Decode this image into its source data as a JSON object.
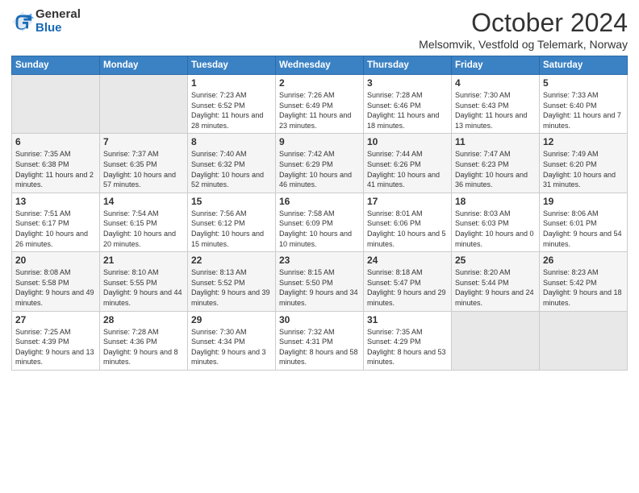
{
  "header": {
    "logo_general": "General",
    "logo_blue": "Blue",
    "month_title": "October 2024",
    "location": "Melsomvik, Vestfold og Telemark, Norway"
  },
  "days_of_week": [
    "Sunday",
    "Monday",
    "Tuesday",
    "Wednesday",
    "Thursday",
    "Friday",
    "Saturday"
  ],
  "weeks": [
    [
      {
        "day": "",
        "info": ""
      },
      {
        "day": "",
        "info": ""
      },
      {
        "day": "1",
        "info": "Sunrise: 7:23 AM\nSunset: 6:52 PM\nDaylight: 11 hours and 28 minutes."
      },
      {
        "day": "2",
        "info": "Sunrise: 7:26 AM\nSunset: 6:49 PM\nDaylight: 11 hours and 23 minutes."
      },
      {
        "day": "3",
        "info": "Sunrise: 7:28 AM\nSunset: 6:46 PM\nDaylight: 11 hours and 18 minutes."
      },
      {
        "day": "4",
        "info": "Sunrise: 7:30 AM\nSunset: 6:43 PM\nDaylight: 11 hours and 13 minutes."
      },
      {
        "day": "5",
        "info": "Sunrise: 7:33 AM\nSunset: 6:40 PM\nDaylight: 11 hours and 7 minutes."
      }
    ],
    [
      {
        "day": "6",
        "info": "Sunrise: 7:35 AM\nSunset: 6:38 PM\nDaylight: 11 hours and 2 minutes."
      },
      {
        "day": "7",
        "info": "Sunrise: 7:37 AM\nSunset: 6:35 PM\nDaylight: 10 hours and 57 minutes."
      },
      {
        "day": "8",
        "info": "Sunrise: 7:40 AM\nSunset: 6:32 PM\nDaylight: 10 hours and 52 minutes."
      },
      {
        "day": "9",
        "info": "Sunrise: 7:42 AM\nSunset: 6:29 PM\nDaylight: 10 hours and 46 minutes."
      },
      {
        "day": "10",
        "info": "Sunrise: 7:44 AM\nSunset: 6:26 PM\nDaylight: 10 hours and 41 minutes."
      },
      {
        "day": "11",
        "info": "Sunrise: 7:47 AM\nSunset: 6:23 PM\nDaylight: 10 hours and 36 minutes."
      },
      {
        "day": "12",
        "info": "Sunrise: 7:49 AM\nSunset: 6:20 PM\nDaylight: 10 hours and 31 minutes."
      }
    ],
    [
      {
        "day": "13",
        "info": "Sunrise: 7:51 AM\nSunset: 6:17 PM\nDaylight: 10 hours and 26 minutes."
      },
      {
        "day": "14",
        "info": "Sunrise: 7:54 AM\nSunset: 6:15 PM\nDaylight: 10 hours and 20 minutes."
      },
      {
        "day": "15",
        "info": "Sunrise: 7:56 AM\nSunset: 6:12 PM\nDaylight: 10 hours and 15 minutes."
      },
      {
        "day": "16",
        "info": "Sunrise: 7:58 AM\nSunset: 6:09 PM\nDaylight: 10 hours and 10 minutes."
      },
      {
        "day": "17",
        "info": "Sunrise: 8:01 AM\nSunset: 6:06 PM\nDaylight: 10 hours and 5 minutes."
      },
      {
        "day": "18",
        "info": "Sunrise: 8:03 AM\nSunset: 6:03 PM\nDaylight: 10 hours and 0 minutes."
      },
      {
        "day": "19",
        "info": "Sunrise: 8:06 AM\nSunset: 6:01 PM\nDaylight: 9 hours and 54 minutes."
      }
    ],
    [
      {
        "day": "20",
        "info": "Sunrise: 8:08 AM\nSunset: 5:58 PM\nDaylight: 9 hours and 49 minutes."
      },
      {
        "day": "21",
        "info": "Sunrise: 8:10 AM\nSunset: 5:55 PM\nDaylight: 9 hours and 44 minutes."
      },
      {
        "day": "22",
        "info": "Sunrise: 8:13 AM\nSunset: 5:52 PM\nDaylight: 9 hours and 39 minutes."
      },
      {
        "day": "23",
        "info": "Sunrise: 8:15 AM\nSunset: 5:50 PM\nDaylight: 9 hours and 34 minutes."
      },
      {
        "day": "24",
        "info": "Sunrise: 8:18 AM\nSunset: 5:47 PM\nDaylight: 9 hours and 29 minutes."
      },
      {
        "day": "25",
        "info": "Sunrise: 8:20 AM\nSunset: 5:44 PM\nDaylight: 9 hours and 24 minutes."
      },
      {
        "day": "26",
        "info": "Sunrise: 8:23 AM\nSunset: 5:42 PM\nDaylight: 9 hours and 18 minutes."
      }
    ],
    [
      {
        "day": "27",
        "info": "Sunrise: 7:25 AM\nSunset: 4:39 PM\nDaylight: 9 hours and 13 minutes."
      },
      {
        "day": "28",
        "info": "Sunrise: 7:28 AM\nSunset: 4:36 PM\nDaylight: 9 hours and 8 minutes."
      },
      {
        "day": "29",
        "info": "Sunrise: 7:30 AM\nSunset: 4:34 PM\nDaylight: 9 hours and 3 minutes."
      },
      {
        "day": "30",
        "info": "Sunrise: 7:32 AM\nSunset: 4:31 PM\nDaylight: 8 hours and 58 minutes."
      },
      {
        "day": "31",
        "info": "Sunrise: 7:35 AM\nSunset: 4:29 PM\nDaylight: 8 hours and 53 minutes."
      },
      {
        "day": "",
        "info": ""
      },
      {
        "day": "",
        "info": ""
      }
    ]
  ]
}
